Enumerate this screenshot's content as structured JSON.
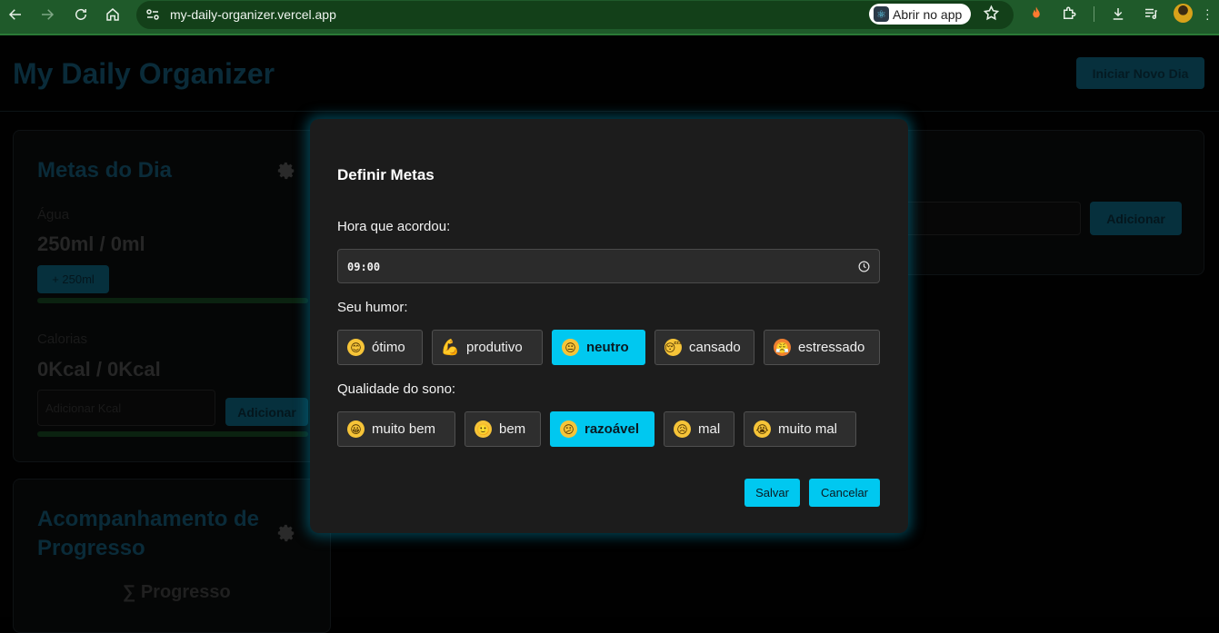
{
  "browser": {
    "url": "my-daily-organizer.vercel.app",
    "open_app_label": "Abrir no app"
  },
  "page": {
    "app_title": "My Daily Organizer",
    "new_day_button": "Iniciar Novo Dia",
    "goals_card": {
      "title": "Metas do Dia",
      "water_label": "Água",
      "water_value": "250ml / 0ml",
      "water_button": "+ 250ml",
      "calories_label": "Calorias",
      "calories_value": "0Kcal / 0Kcal",
      "calories_placeholder": "Adicionar Kcal",
      "calories_button": "Adicionar"
    },
    "tasks_card": {
      "add_button": "Adicionar"
    },
    "progress_card": {
      "title": "Acompanhamento de Progresso",
      "subtitle": "∑ Progresso"
    }
  },
  "modal": {
    "title": "Definir Metas",
    "wake_label": "Hora que acordou:",
    "wake_value": "09:00",
    "mood_label": "Seu humor:",
    "mood_options": [
      {
        "emoji": "😊",
        "label": "ótimo",
        "selected": false
      },
      {
        "emoji": "💪",
        "label": "produtivo",
        "selected": false
      },
      {
        "emoji": "😐",
        "label": "neutro",
        "selected": true
      },
      {
        "emoji": "😴",
        "label": "cansado",
        "selected": false
      },
      {
        "emoji": "😤",
        "label": "estressado",
        "selected": false
      }
    ],
    "sleep_label": "Qualidade do sono:",
    "sleep_options": [
      {
        "emoji": "😀",
        "label": "muito bem",
        "selected": false
      },
      {
        "emoji": "🙂",
        "label": "bem",
        "selected": false
      },
      {
        "emoji": "😕",
        "label": "razoável",
        "selected": true
      },
      {
        "emoji": "😥",
        "label": "mal",
        "selected": false
      },
      {
        "emoji": "😭",
        "label": "muito mal",
        "selected": false
      }
    ],
    "save_button": "Salvar",
    "cancel_button": "Cancelar"
  },
  "colors": {
    "accent": "#00c8f0",
    "chrome": "#1f5a2a"
  }
}
